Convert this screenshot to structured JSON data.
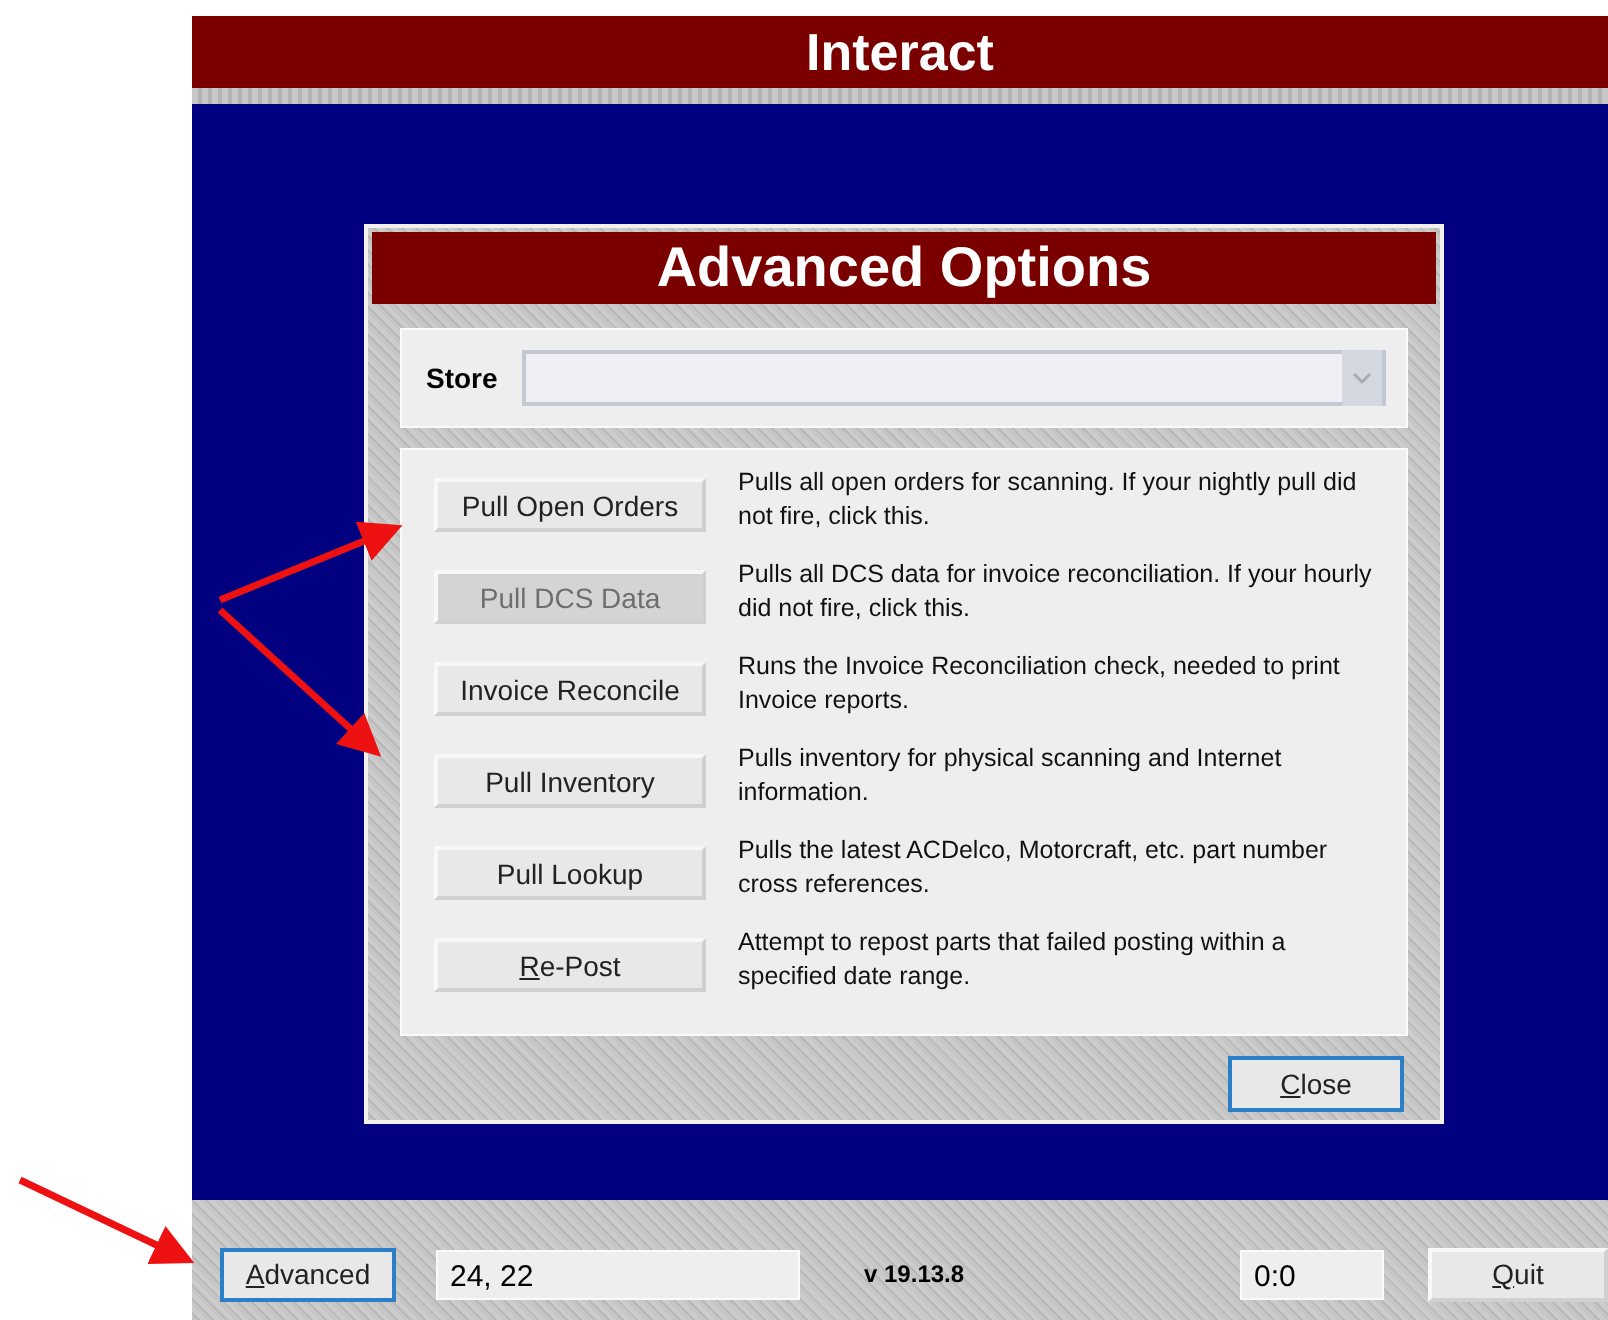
{
  "window": {
    "title": "Interact"
  },
  "dialog": {
    "title": "Advanced Options",
    "store": {
      "label": "Store"
    },
    "options": [
      {
        "button": "Pull Open Orders",
        "disabled": false,
        "underline_first": false,
        "description": "Pulls all open orders for scanning. If your nightly pull did not fire, click this."
      },
      {
        "button": "Pull DCS Data",
        "disabled": true,
        "underline_first": false,
        "description": "Pulls all DCS data for invoice reconciliation. If your hourly did not fire, click this."
      },
      {
        "button": "Invoice Reconcile",
        "disabled": false,
        "underline_first": false,
        "description": "Runs the Invoice Reconciliation check, needed to print Invoice reports."
      },
      {
        "button": "Pull Inventory",
        "disabled": false,
        "underline_first": false,
        "description": "Pulls inventory for physical scanning and Internet information."
      },
      {
        "button": "Pull Lookup",
        "disabled": false,
        "underline_first": false,
        "description": "Pulls the latest ACDelco, Motorcraft, etc. part number cross references."
      },
      {
        "button": "Re-Post",
        "disabled": false,
        "underline_first": true,
        "description": "Attempt to repost parts that failed posting within a specified date range."
      }
    ],
    "close_button": {
      "label": "Close",
      "focused": true,
      "underline_first": true
    }
  },
  "status_bar": {
    "advanced_button": {
      "label": "Advanced",
      "focused": true,
      "underline_first": true
    },
    "position": "24, 22",
    "version": "v 19.13.8",
    "counter": "0:0",
    "quit_button": {
      "label": "Quit",
      "focused": false,
      "underline_first": true
    }
  }
}
